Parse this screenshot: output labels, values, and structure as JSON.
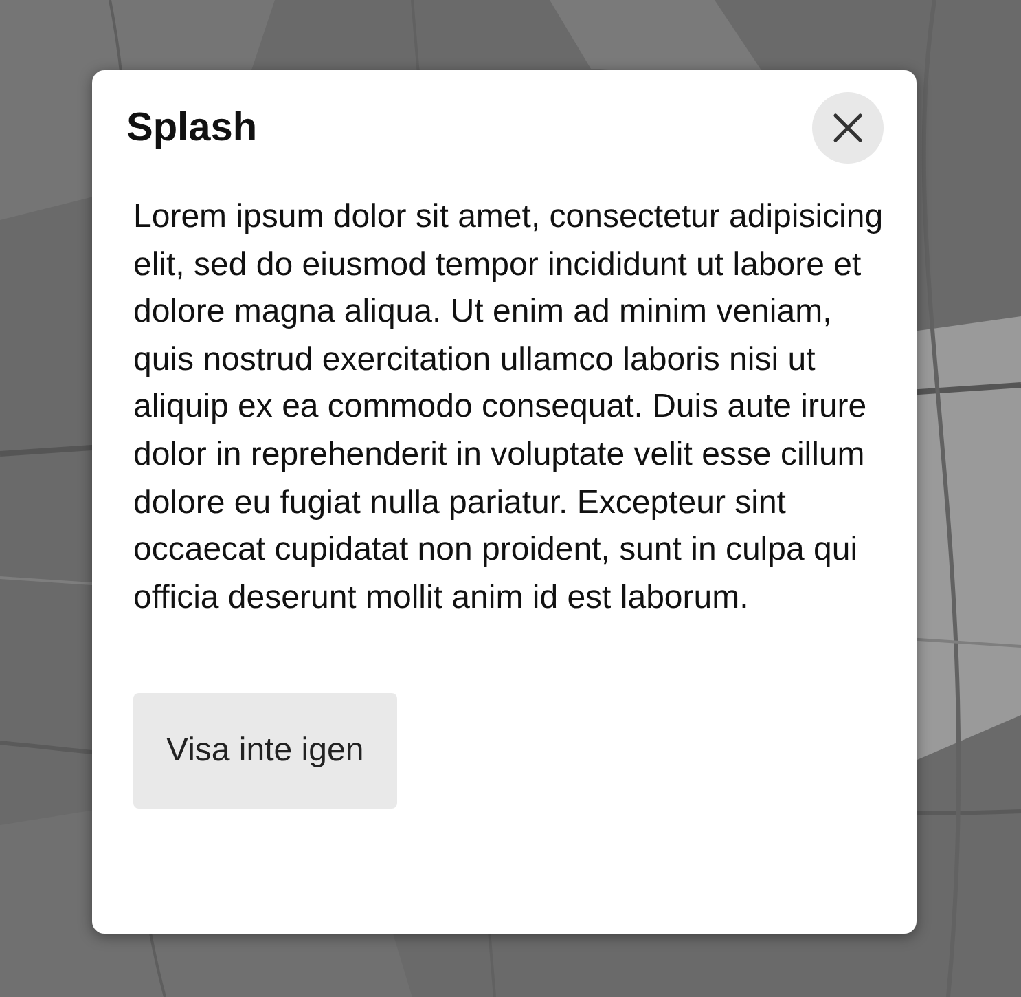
{
  "dialog": {
    "title": "Splash",
    "body": "Lorem ipsum dolor sit amet, consectetur adipisicing elit, sed do eiusmod tempor incididunt ut labore et dolore magna aliqua. Ut enim ad minim veniam, quis nostrud exercitation ullamco laboris nisi ut aliquip ex ea commodo consequat. Duis aute irure dolor in reprehenderit in voluptate velit esse cillum dolore eu fugiat nulla pariatur. Excepteur sint occaecat cupidatat non proident, sunt in culpa qui officia deserunt mollit anim id est laborum.",
    "buttons": [
      "Visa inte igen"
    ]
  }
}
